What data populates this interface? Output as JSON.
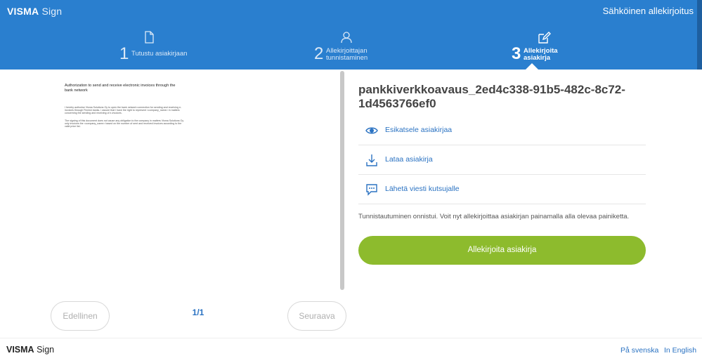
{
  "header": {
    "brand_bold": "VISMA",
    "brand_light": "Sign",
    "title": "Sähköinen allekirjoitus"
  },
  "steps": [
    {
      "number": "1",
      "label_line1": "Tutustu asiakirjaan",
      "label_line2": "",
      "icon": "document-icon",
      "active": false
    },
    {
      "number": "2",
      "label_line1": "Allekirjoittajan",
      "label_line2": "tunnistaminen",
      "icon": "user-icon",
      "active": false
    },
    {
      "number": "3",
      "label_line1": "Allekirjoita",
      "label_line2": "asiakirja",
      "icon": "sign-edit-icon",
      "active": true
    }
  ],
  "document": {
    "title": "Authorization to send and receive electronic invoices through the bank network",
    "paragraph1": "I hereby authorise Visma Solutions Oy to open the bank network connection for sending and receiving e-invoices through Finnish banks. I assure that I have the right to represent <company_name> in matters concerning the sending and receiving of e-invoices.",
    "paragraph2": "The signing of this document does not cause any obligation to the company in matters Visma Solutions Oy only invoices the <company_name> based on the number of sent and received invoices according to the valid price list."
  },
  "pager": {
    "prev_label": "Edellinen",
    "page_indicator": "1/1",
    "next_label": "Seuraava"
  },
  "panel": {
    "file_name": "pankkiverkkoavaus_2ed4c338-91b5-482c-8c72-1d4563766ef0",
    "actions": [
      {
        "label": "Esikatsele asiakirjaa",
        "icon": "eye-icon"
      },
      {
        "label": "Lataa asiakirja",
        "icon": "download-icon"
      },
      {
        "label": "Lähetä viesti kutsujalle",
        "icon": "message-icon"
      }
    ],
    "info_text": "Tunnistautuminen onnistui. Voit nyt allekirjoittaa asiakirjan painamalla alla olevaa painiketta.",
    "sign_button": "Allekirjoita asiakirja"
  },
  "footer": {
    "brand_bold": "VISMA",
    "brand_light": "Sign",
    "lang_sv": "På svenska",
    "lang_en": "In English"
  },
  "colors": {
    "header_blue": "#2a7fcf",
    "link_blue": "#2a72c2",
    "sign_green": "#8dbb2d"
  }
}
